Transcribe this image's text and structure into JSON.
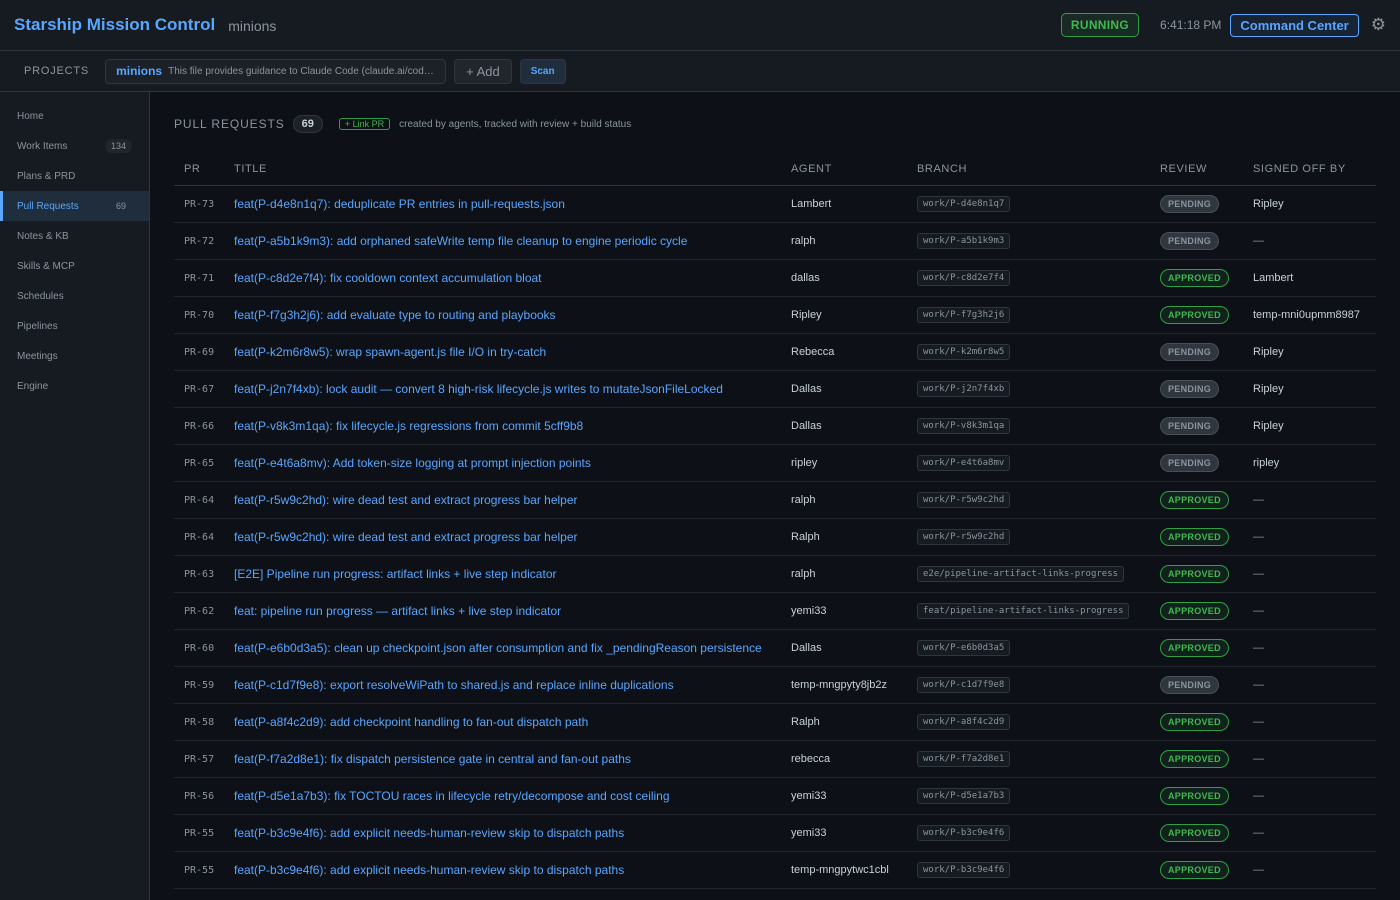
{
  "header": {
    "title": "Starship Mission Control",
    "subtitle": "minions",
    "status": "RUNNING",
    "clock": "6:41:18 PM",
    "command_center": "Command Center",
    "settings_icon": "gear-icon"
  },
  "projects": {
    "label": "PROJECTS",
    "current_name": "minions",
    "current_desc": "This file provides guidance to Claude Code (claude.ai/code) ...",
    "add_label": "+ Add",
    "scan_label": "Scan"
  },
  "sidebar": {
    "items": [
      {
        "label": "Home",
        "count": ""
      },
      {
        "label": "Work Items",
        "count": "134"
      },
      {
        "label": "Plans & PRD",
        "count": ""
      },
      {
        "label": "Pull Requests",
        "count": "69",
        "active": true
      },
      {
        "label": "Notes & KB",
        "count": ""
      },
      {
        "label": "Skills & MCP",
        "count": ""
      },
      {
        "label": "Schedules",
        "count": ""
      },
      {
        "label": "Pipelines",
        "count": ""
      },
      {
        "label": "Meetings",
        "count": ""
      },
      {
        "label": "Engine",
        "count": ""
      }
    ]
  },
  "pulls": {
    "title": "PULL REQUESTS",
    "count": "69",
    "link_label": "+ Link PR",
    "note": "created by agents, tracked with review + build status",
    "columns": [
      "PR",
      "TITLE",
      "AGENT",
      "BRANCH",
      "REVIEW",
      "SIGNED OFF BY"
    ],
    "rows": [
      {
        "pr": "PR-73",
        "title": "feat(P-d4e8n1q7): deduplicate PR entries in pull-requests.json",
        "agent": "Lambert",
        "branch": "work/P-d4e8n1q7",
        "review": "PENDING",
        "signed": "Ripley"
      },
      {
        "pr": "PR-72",
        "title": "feat(P-a5b1k9m3): add orphaned safeWrite temp file cleanup to engine periodic cycle",
        "agent": "ralph",
        "branch": "work/P-a5b1k9m3",
        "review": "PENDING",
        "signed": "—"
      },
      {
        "pr": "PR-71",
        "title": "feat(P-c8d2e7f4): fix cooldown context accumulation bloat",
        "agent": "dallas",
        "branch": "work/P-c8d2e7f4",
        "review": "APPROVED",
        "signed": "Lambert"
      },
      {
        "pr": "PR-70",
        "title": "feat(P-f7g3h2j6): add evaluate type to routing and playbooks",
        "agent": "Ripley",
        "branch": "work/P-f7g3h2j6",
        "review": "APPROVED",
        "signed": "temp-mni0upmm8987"
      },
      {
        "pr": "PR-69",
        "title": "feat(P-k2m6r8w5): wrap spawn-agent.js file I/O in try-catch",
        "agent": "Rebecca",
        "branch": "work/P-k2m6r8w5",
        "review": "PENDING",
        "signed": "Ripley"
      },
      {
        "pr": "PR-67",
        "title": "feat(P-j2n7f4xb): lock audit — convert 8 high-risk lifecycle.js writes to mutateJsonFileLocked",
        "agent": "Dallas",
        "branch": "work/P-j2n7f4xb",
        "review": "PENDING",
        "signed": "Ripley"
      },
      {
        "pr": "PR-66",
        "title": "feat(P-v8k3m1qa): fix lifecycle.js regressions from commit 5cff9b8",
        "agent": "Dallas",
        "branch": "work/P-v8k3m1qa",
        "review": "PENDING",
        "signed": "Ripley"
      },
      {
        "pr": "PR-65",
        "title": "feat(P-e4t6a8mv): Add token-size logging at prompt injection points",
        "agent": "ripley",
        "branch": "work/P-e4t6a8mv",
        "review": "PENDING",
        "signed": "ripley"
      },
      {
        "pr": "PR-64",
        "title": "feat(P-r5w9c2hd): wire dead test and extract progress bar helper",
        "agent": "ralph",
        "branch": "work/P-r5w9c2hd",
        "review": "APPROVED",
        "signed": "—"
      },
      {
        "pr": "PR-64",
        "title": "feat(P-r5w9c2hd): wire dead test and extract progress bar helper",
        "agent": "Ralph",
        "branch": "work/P-r5w9c2hd",
        "review": "APPROVED",
        "signed": "—"
      },
      {
        "pr": "PR-63",
        "title": "[E2E] Pipeline run progress: artifact links + live step indicator",
        "agent": "ralph",
        "branch": "e2e/pipeline-artifact-links-progress",
        "review": "APPROVED",
        "signed": "—"
      },
      {
        "pr": "PR-62",
        "title": "feat: pipeline run progress — artifact links + live step indicator",
        "agent": "yemi33",
        "branch": "feat/pipeline-artifact-links-progress",
        "review": "APPROVED",
        "signed": "—"
      },
      {
        "pr": "PR-60",
        "title": "feat(P-e6b0d3a5): clean up checkpoint.json after consumption and fix _pendingReason persistence",
        "agent": "Dallas",
        "branch": "work/P-e6b0d3a5",
        "review": "APPROVED",
        "signed": "—"
      },
      {
        "pr": "PR-59",
        "title": "feat(P-c1d7f9e8): export resolveWiPath to shared.js and replace inline duplications",
        "agent": "temp-mngpyty8jb2z",
        "branch": "work/P-c1d7f9e8",
        "review": "PENDING",
        "signed": "—"
      },
      {
        "pr": "PR-58",
        "title": "feat(P-a8f4c2d9): add checkpoint handling to fan-out dispatch path",
        "agent": "Ralph",
        "branch": "work/P-a8f4c2d9",
        "review": "APPROVED",
        "signed": "—"
      },
      {
        "pr": "PR-57",
        "title": "feat(P-f7a2d8e1): fix dispatch persistence gate in central and fan-out paths",
        "agent": "rebecca",
        "branch": "work/P-f7a2d8e1",
        "review": "APPROVED",
        "signed": "—"
      },
      {
        "pr": "PR-56",
        "title": "feat(P-d5e1a7b3): fix TOCTOU races in lifecycle retry/decompose and cost ceiling",
        "agent": "yemi33",
        "branch": "work/P-d5e1a7b3",
        "review": "APPROVED",
        "signed": "—"
      },
      {
        "pr": "PR-55",
        "title": "feat(P-b3c9e4f6): add explicit needs-human-review skip to dispatch paths",
        "agent": "yemi33",
        "branch": "work/P-b3c9e4f6",
        "review": "APPROVED",
        "signed": "—"
      },
      {
        "pr": "PR-55",
        "title": "feat(P-b3c9e4f6): add explicit needs-human-review skip to dispatch paths",
        "agent": "temp-mngpytwc1cbl",
        "branch": "work/P-b3c9e4f6",
        "review": "APPROVED",
        "signed": "—"
      }
    ]
  },
  "colors": {
    "accent": "#58a6ff",
    "approved": "#3fb950",
    "background": "#0d1117",
    "panel": "#161b22"
  }
}
